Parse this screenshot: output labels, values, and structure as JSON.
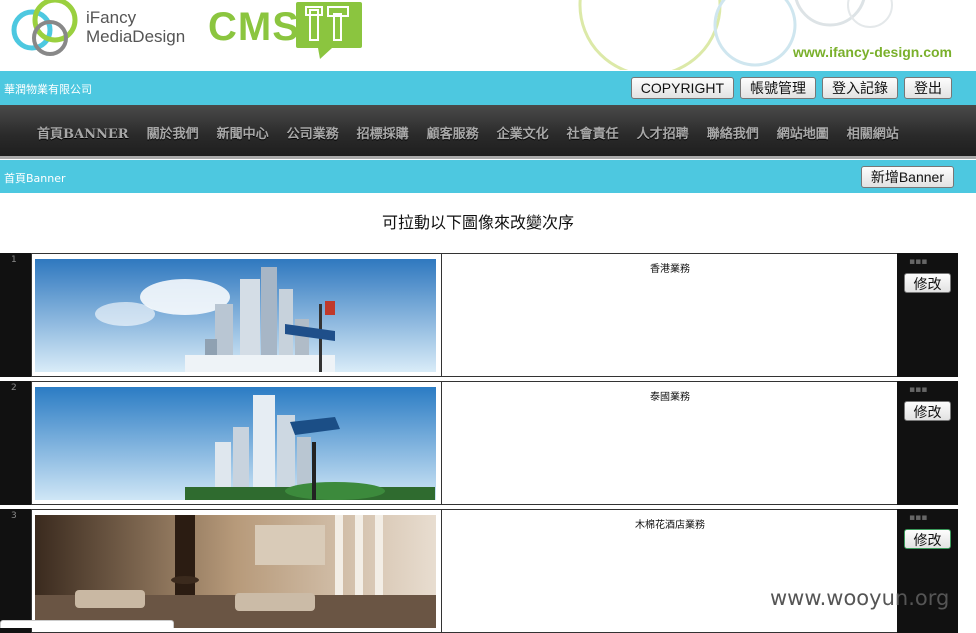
{
  "header": {
    "logo_line1": "iFancy",
    "logo_line2": "MediaDesign",
    "cms_label": "CMS",
    "site_url": "www.ifancy-design.com",
    "brand_green": "#8bc53f",
    "brand_blue": "#4dc8e0"
  },
  "topbar": {
    "company": "華潤物業有限公司",
    "buttons": [
      "COPYRIGHT",
      "帳號管理",
      "登入記錄",
      "登出"
    ]
  },
  "nav": {
    "items": [
      "首頁BANNER",
      "關於我們",
      "新聞中心",
      "公司業務",
      "招標採購",
      "顧客服務",
      "企業文化",
      "社會責任",
      "人才招聘",
      "聯絡我們",
      "網站地圖",
      "相關網站"
    ]
  },
  "section": {
    "title": "首頁Banner",
    "add_button": "新增Banner",
    "hint": "可拉動以下圖像來改變次序"
  },
  "rows": [
    {
      "name": "香港業務",
      "edit_label": "修改",
      "banner_icon": "hong-kong-skyline-banner"
    },
    {
      "name": "泰國業務",
      "edit_label": "修改",
      "banner_icon": "thailand-skyline-banner"
    },
    {
      "name": "木棉花酒店業務",
      "edit_label": "修改",
      "banner_icon": "hotel-lobby-banner"
    }
  ],
  "watermark": "www.wooyun.org"
}
